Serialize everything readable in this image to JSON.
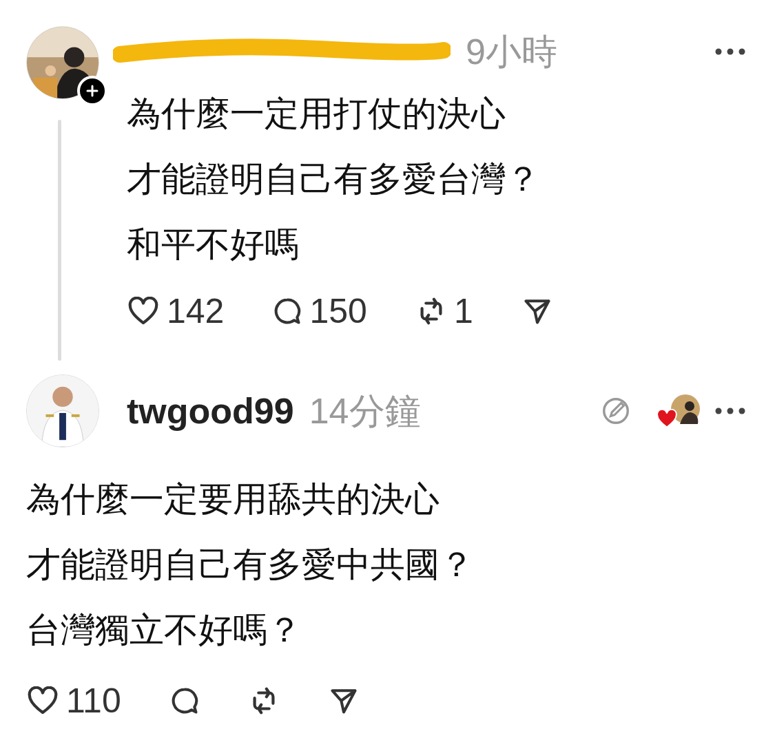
{
  "posts": [
    {
      "thread_line": true,
      "username_redacted": true,
      "follow_badge": true,
      "time": "9小時",
      "lines": [
        "為什麼一定用打仗的決心",
        "才能證明自己有多愛台灣？",
        "和平不好嗎"
      ],
      "actions": [
        {
          "kind": "like",
          "count": "142"
        },
        {
          "kind": "reply",
          "count": "150"
        },
        {
          "kind": "repost",
          "count": "1"
        },
        {
          "kind": "share"
        }
      ]
    },
    {
      "thread_line": false,
      "username": "twgood99",
      "time": "14分鐘",
      "edit_icon": true,
      "reaction_avatar": true,
      "lines": [
        "為什麼一定要用舔共的決心",
        "才能證明自己有多愛中共國？",
        "台灣獨立不好嗎？"
      ],
      "actions": [
        {
          "kind": "like",
          "count": "110"
        },
        {
          "kind": "reply"
        },
        {
          "kind": "repost"
        },
        {
          "kind": "share"
        }
      ]
    }
  ]
}
